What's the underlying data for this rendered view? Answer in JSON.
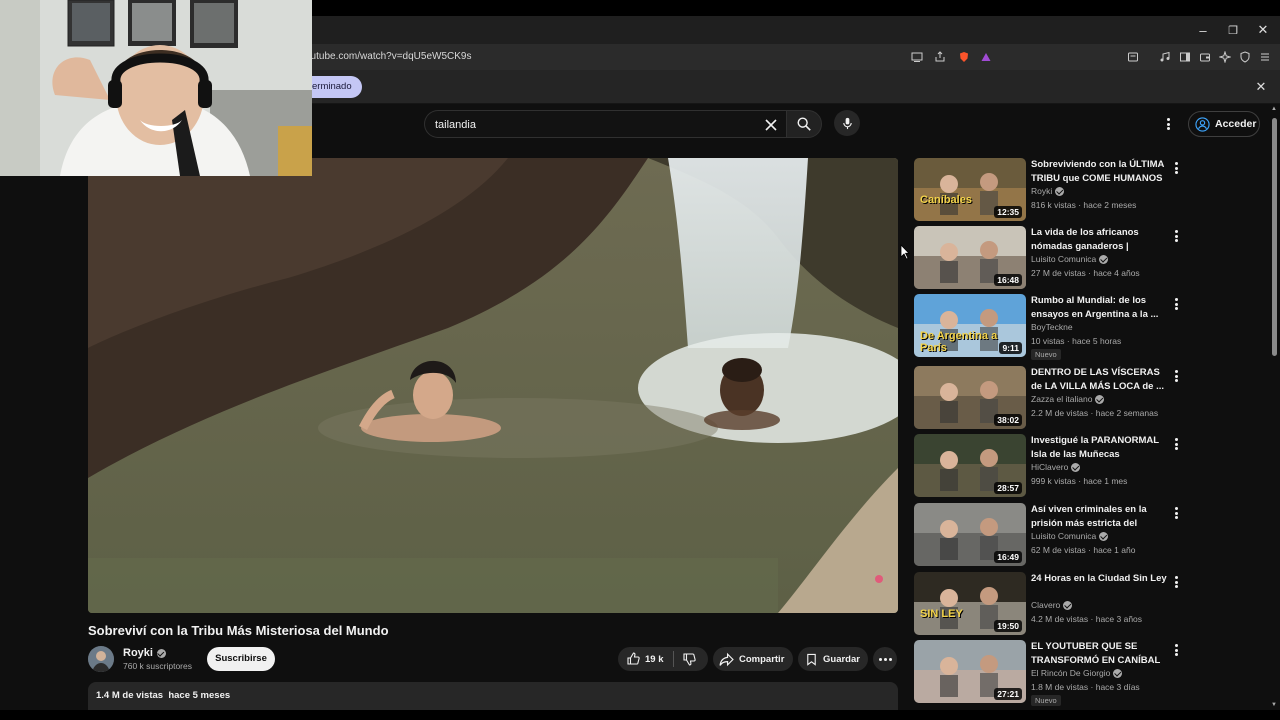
{
  "browser": {
    "url": "youtube.com/watch?v=dqU5eW5CK9s",
    "window_controls": [
      "–",
      "❐",
      "✕"
    ],
    "infobar_text": "erminado",
    "infobar_close": "✕"
  },
  "header": {
    "search_value": "tailandia",
    "signin_label": "Acceder"
  },
  "video": {
    "title": "Sobreviví con la Tribu Más Misteriosa del Mundo",
    "channel": "Royki",
    "subscribers": "760 k suscriptores",
    "subscribe_label": "Suscribirse",
    "likes": "19 k",
    "share_label": "Compartir",
    "save_label": "Guardar",
    "views": "1.4 M de vistas",
    "age": "hace 5 meses"
  },
  "recommendations": [
    {
      "title": "Sobreviviendo con la ÚLTIMA TRIBU que COME HUMANOS ...",
      "channel": "Royki",
      "verified": true,
      "meta": "816 k vistas · hace 2 meses",
      "duration": "12:35",
      "badge": "",
      "thumb_overlay": "Caníbales"
    },
    {
      "title": "La vida de los africanos nómadas ganaderos | Mundiari...",
      "channel": "Luisito Comunica",
      "verified": true,
      "meta": "27 M de vistas · hace 4 años",
      "duration": "16:48",
      "badge": "",
      "thumb_overlay": ""
    },
    {
      "title": "Rumbo al Mundial: de los ensayos en Argentina a la ...",
      "channel": "BoyTeckne",
      "verified": false,
      "meta": "10 vistas · hace 5 horas",
      "duration": "9:11",
      "badge": "Nuevo",
      "thumb_overlay": "De Argentina a París"
    },
    {
      "title": "DENTRO DE LAS VÍSCERAS de LA VILLA MÁS LOCA de ...",
      "channel": "Zazza el italiano",
      "verified": true,
      "meta": "2.2 M de vistas · hace 2 semanas",
      "duration": "38:02",
      "badge": "",
      "thumb_overlay": ""
    },
    {
      "title": "Investigué la PARANORMAL Isla de las Muñecas",
      "channel": "HiClavero",
      "verified": true,
      "meta": "999 k vistas · hace 1 mes",
      "duration": "28:57",
      "badge": "",
      "thumb_overlay": ""
    },
    {
      "title": "Así viven criminales en la prisión más estricta del mund...",
      "channel": "Luisito Comunica",
      "verified": true,
      "meta": "62 M de vistas · hace 1 año",
      "duration": "16:49",
      "badge": "",
      "thumb_overlay": ""
    },
    {
      "title": "24 Horas en la Ciudad Sin Ley",
      "channel": "Clavero",
      "verified": true,
      "meta": "4.2 M de vistas · hace 3 años",
      "duration": "19:50",
      "badge": "",
      "thumb_overlay": "SIN LEY"
    },
    {
      "title": "EL YOUTUBER QUE SE TRANSFORMÓ EN CANÍBAL ...",
      "channel": "El Rincón De Giorgio",
      "verified": true,
      "meta": "1.8 M de vistas · hace 3 días",
      "duration": "27:21",
      "badge": "Nuevo",
      "thumb_overlay": ""
    }
  ],
  "colors": {
    "background": "#0f0f0f",
    "surface": "#272727",
    "text": "#f1f1f1",
    "secondary_text": "#aaaaaa",
    "infobar_pill": "#c4c7f5"
  }
}
